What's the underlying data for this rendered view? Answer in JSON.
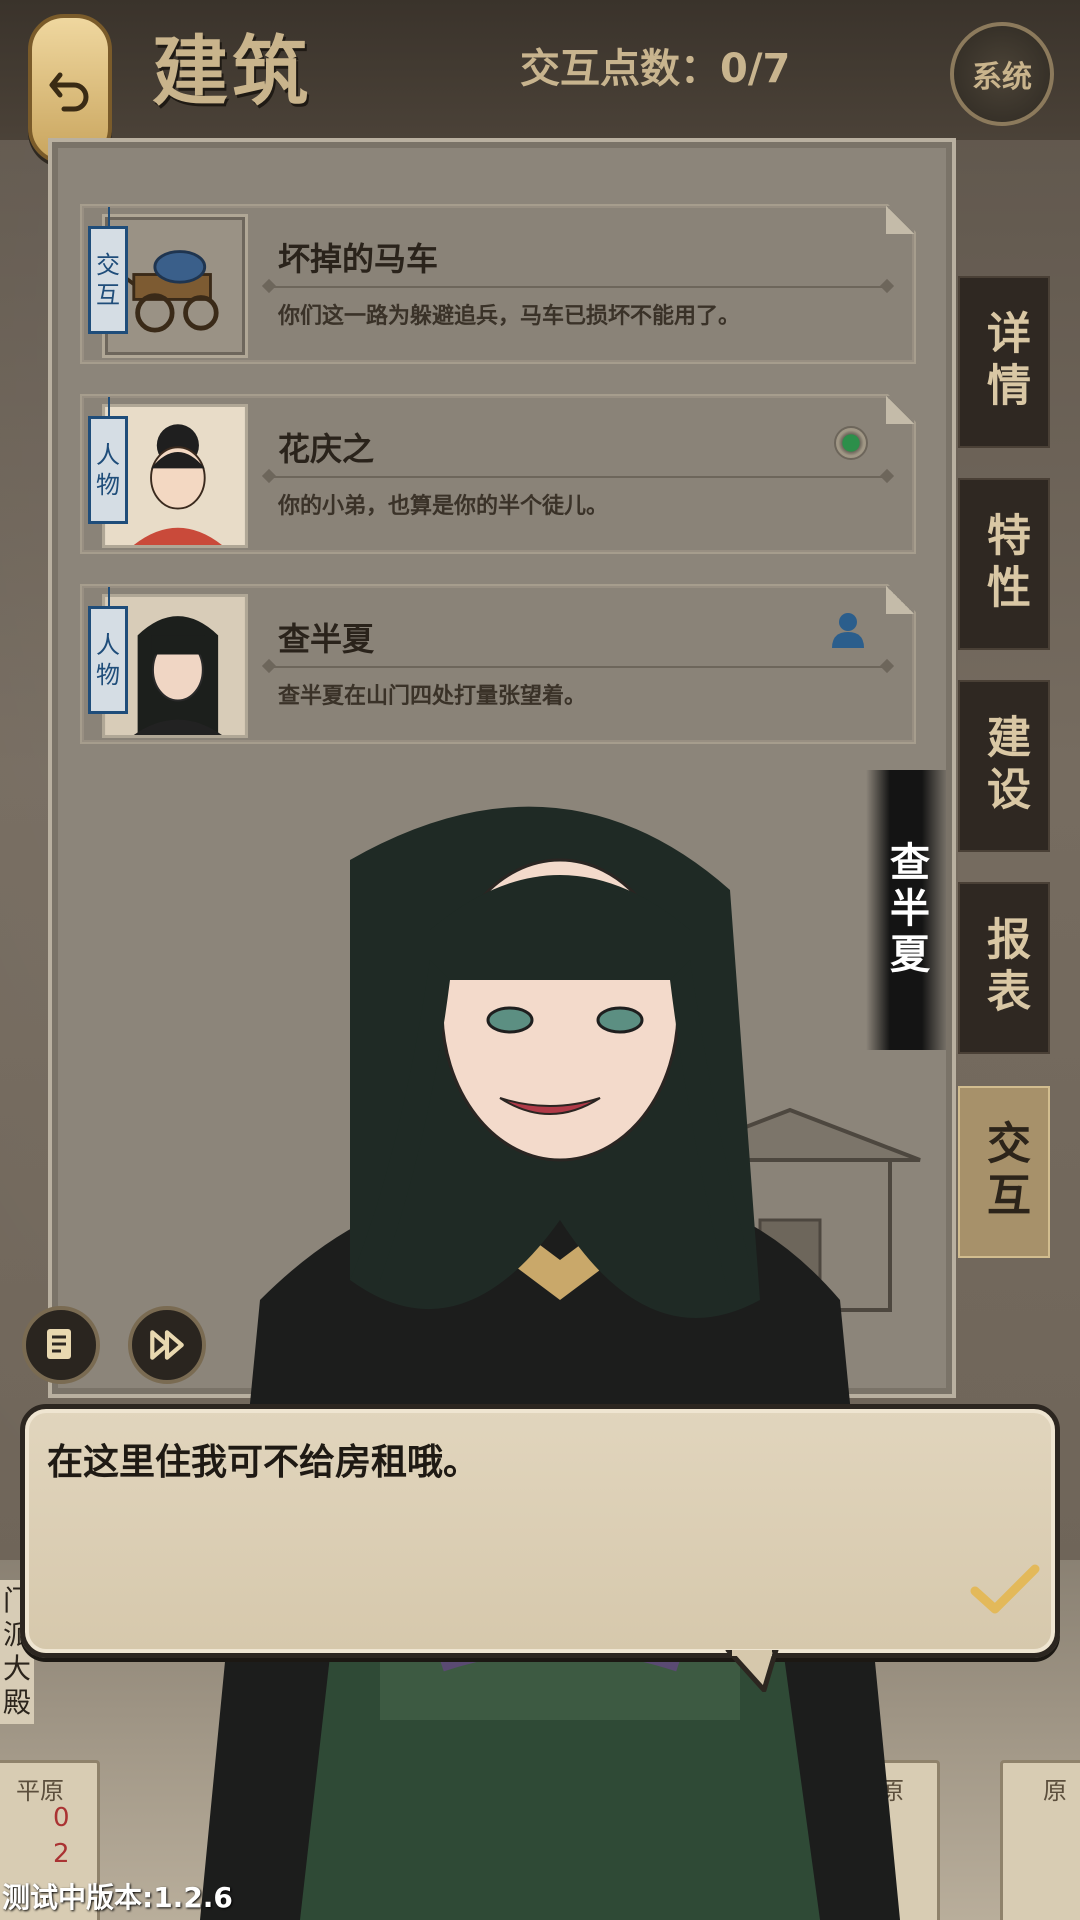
{
  "header": {
    "page_title": "建筑",
    "points_label": "交互点数：0/7",
    "system_label": "系统"
  },
  "cards": [
    {
      "tag_line1": "交",
      "tag_line2": "互",
      "title": "坏掉的马车",
      "desc": "你们这一路为躲避追兵，马车已损坏不能用了。",
      "status_icon": "none"
    },
    {
      "tag_line1": "人",
      "tag_line2": "物",
      "title": "花庆之",
      "desc": "你的小弟，也算是你的半个徒儿。",
      "status_icon": "green-dot-icon"
    },
    {
      "tag_line1": "人",
      "tag_line2": "物",
      "title": "查半夏",
      "desc": "查半夏在山门四处打量张望着。",
      "status_icon": "person-icon"
    }
  ],
  "character_name": "查半夏",
  "side_tabs": [
    {
      "label": "详情",
      "active": false
    },
    {
      "label": "特性",
      "active": false
    },
    {
      "label": "建设",
      "active": false
    },
    {
      "label": "报表",
      "active": false
    },
    {
      "label": "交互",
      "active": true
    }
  ],
  "dialog": {
    "text": "在这里住我可不给房租哦。"
  },
  "background": {
    "vertical_label": "门派大殿",
    "tile_left": "平原",
    "tile_right": "平原",
    "tile_far_right": "原",
    "tile_left_values": [
      "0",
      "2"
    ]
  },
  "version_label": "测试中版本:1.2.6",
  "colors": {
    "accent_gold": "#c9b48c",
    "active_tab": "#a7916a",
    "tag_blue": "#1f4d7a",
    "status_green": "#2c8f4a"
  }
}
